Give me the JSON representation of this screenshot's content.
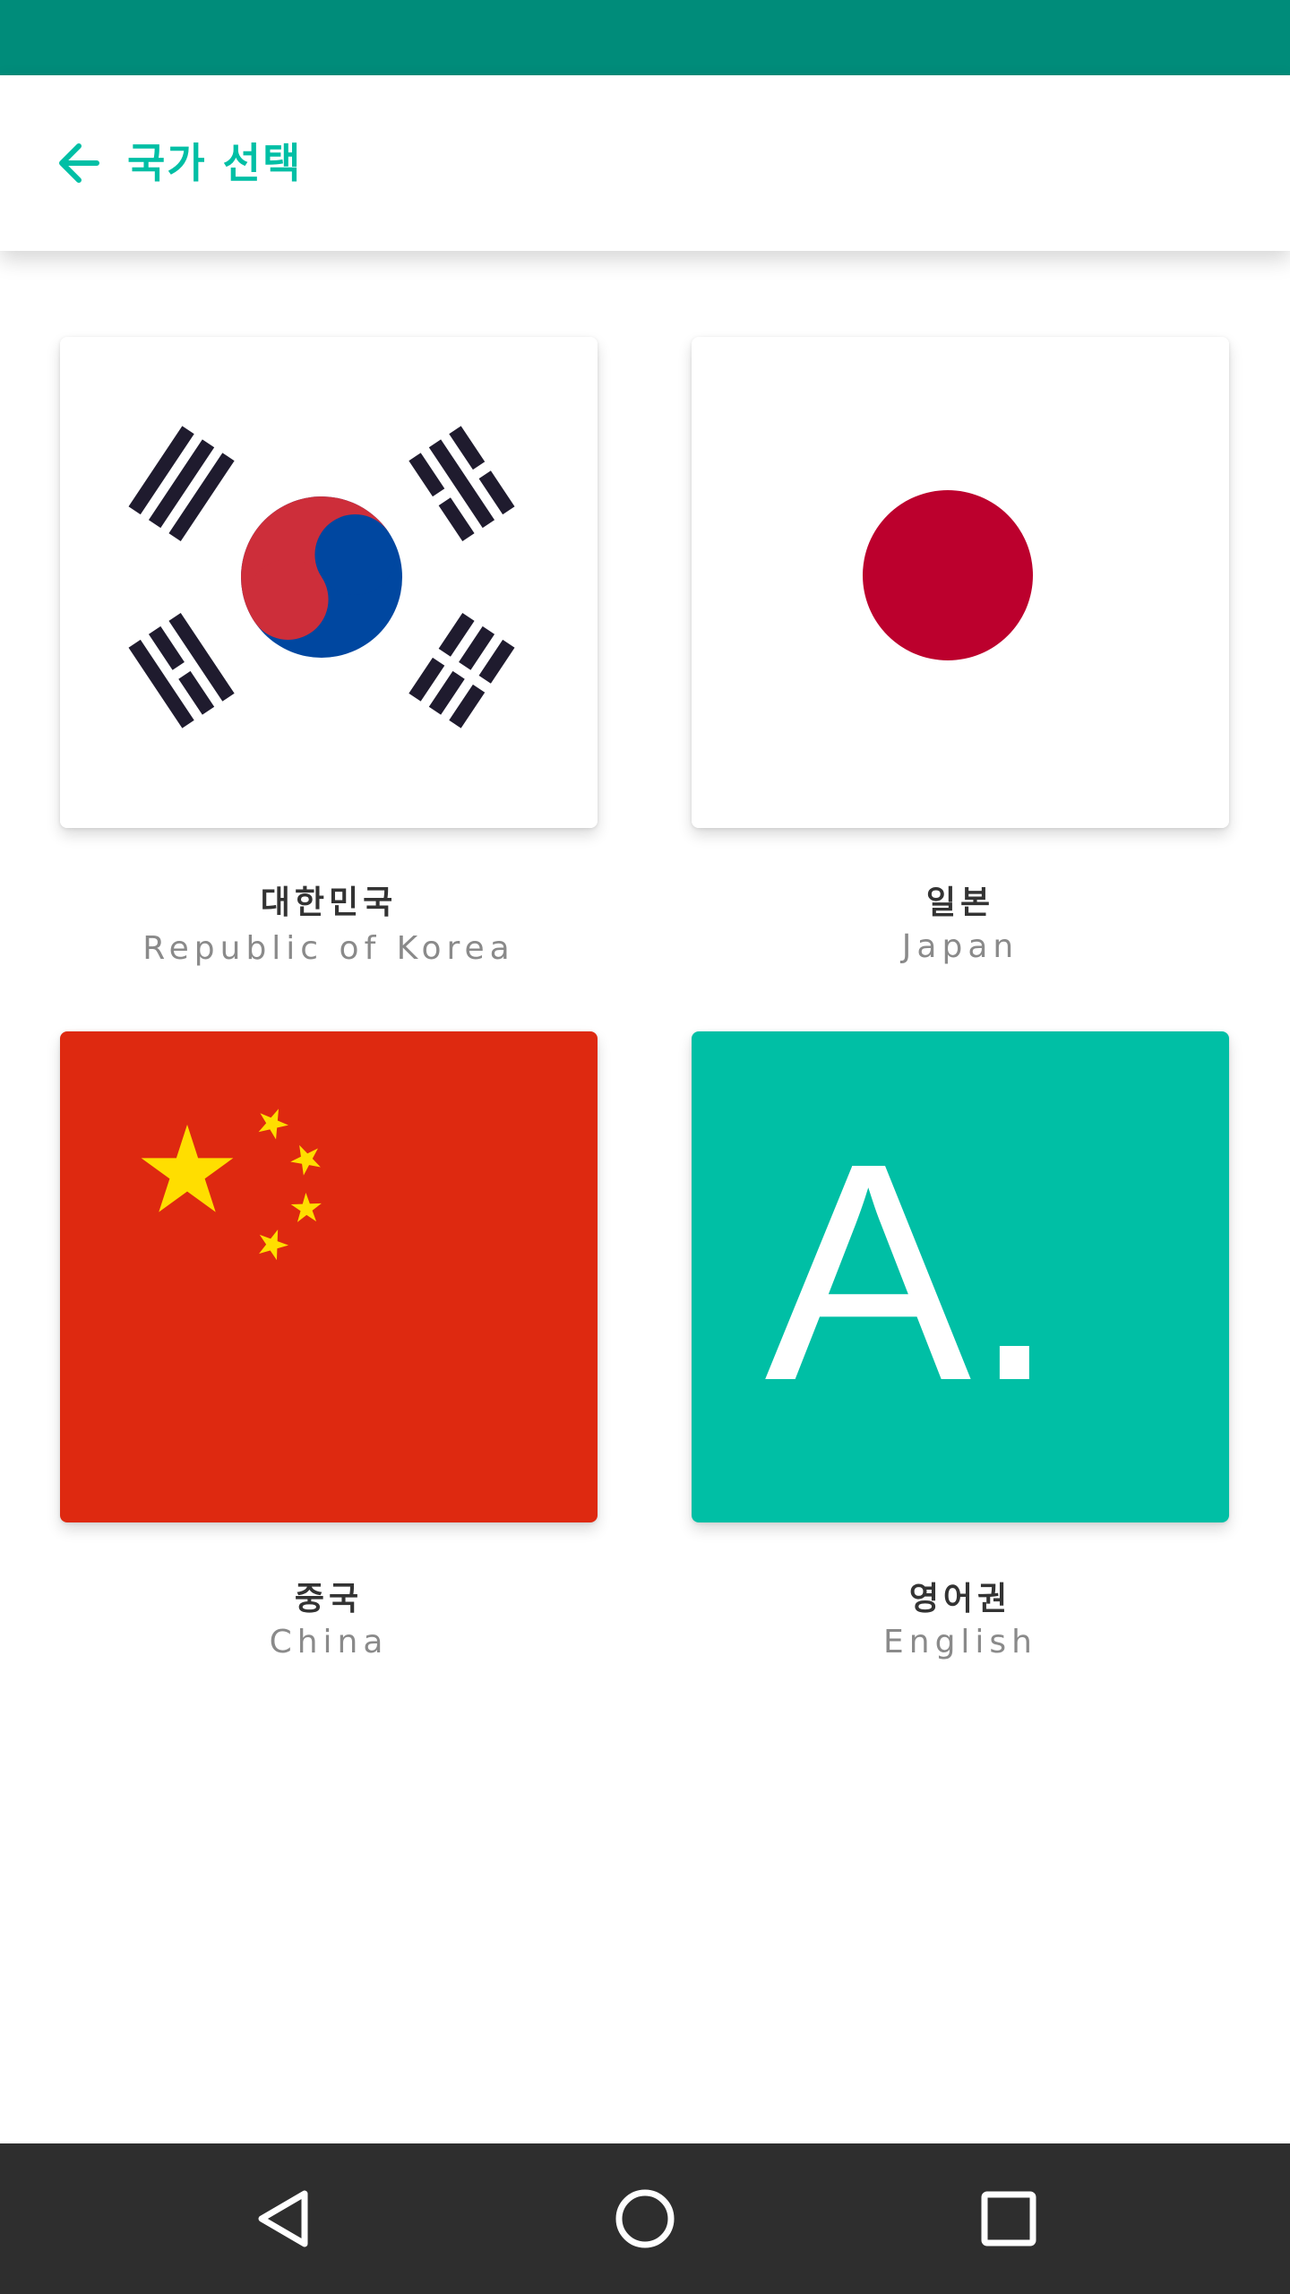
{
  "header": {
    "title": "국가 선택",
    "back_icon": "arrow-back-icon",
    "accent_color": "#00BFA5",
    "status_bar_color": "#008C7A"
  },
  "countries": [
    {
      "id": "kr",
      "name_ko": "대한민국",
      "name_en": "Republic of Korea",
      "flag_icon": "korea-flag-icon"
    },
    {
      "id": "jp",
      "name_ko": "일본",
      "name_en": "Japan",
      "flag_icon": "japan-flag-icon"
    },
    {
      "id": "cn",
      "name_ko": "중국",
      "name_en": "China",
      "flag_icon": "china-flag-icon"
    },
    {
      "id": "en",
      "name_ko": "영어권",
      "name_en": "English",
      "flag_icon": "english-tile-icon",
      "tile_text": "A."
    }
  ],
  "nav": {
    "back_icon": "triangle-back-icon",
    "home_icon": "circle-home-icon",
    "recents_icon": "square-recents-icon",
    "background_color": "#2E2E2E"
  }
}
